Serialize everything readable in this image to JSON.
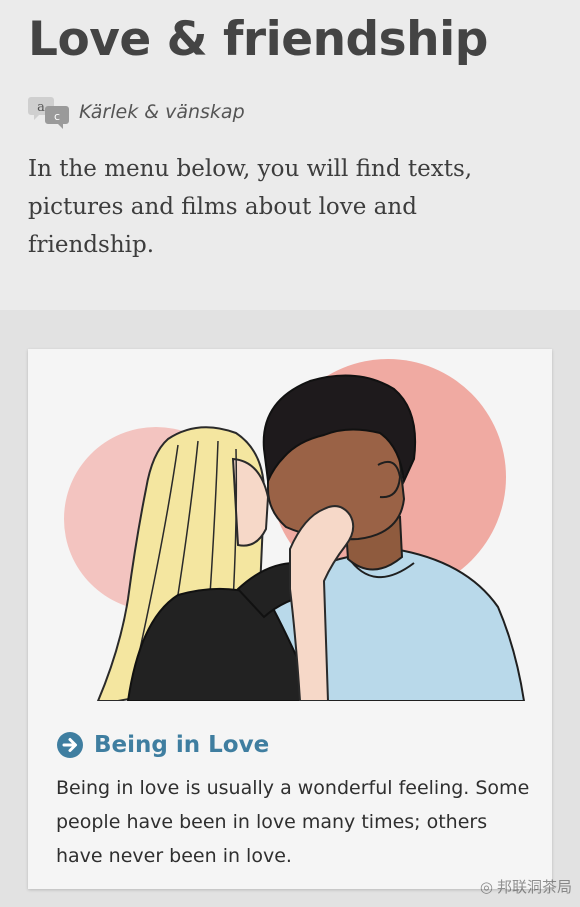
{
  "header": {
    "title": "Love & friendship",
    "language_icon": "translate-icon",
    "language_label": "Kärlek & vänskap",
    "intro": "In the menu below, you will find texts, pictures and films about love and friendship."
  },
  "card": {
    "image_icon": "couple-kissing-illustration",
    "link_icon": "arrow-right-circle-icon",
    "title": "Being in Love",
    "description": "Being in love is usually a wonderful feeling. Some people have been in love many times; others have never been in love."
  },
  "watermark": {
    "text": "邦联洞茶局"
  },
  "colors": {
    "link": "#3f7ea0",
    "circle": "#f2b6b0",
    "shirt": "#b9d9ea"
  }
}
